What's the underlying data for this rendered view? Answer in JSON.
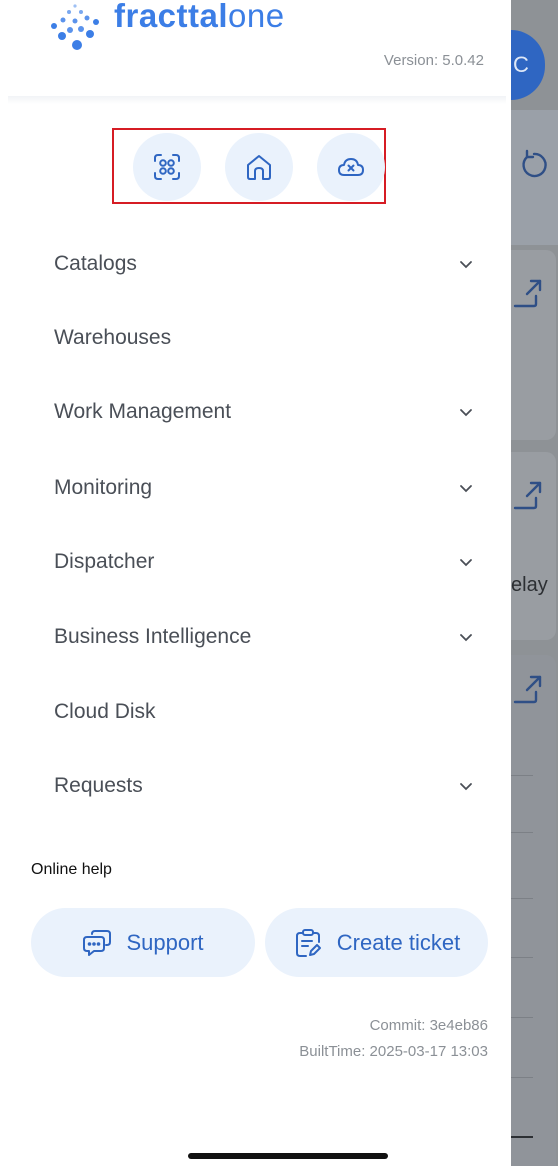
{
  "app": {
    "brand_name": "fracttal",
    "brand_suffix": "one",
    "version": "Version: 5.0.42"
  },
  "quick_actions": [
    {
      "name": "scan",
      "icon": "scan-icon"
    },
    {
      "name": "home",
      "icon": "home-icon"
    },
    {
      "name": "offline-cloud",
      "icon": "cloud-off-icon"
    }
  ],
  "menu": {
    "items": [
      {
        "label": "Catalogs",
        "expandable": true
      },
      {
        "label": "Warehouses",
        "expandable": false
      },
      {
        "label": "Work Management",
        "expandable": true
      },
      {
        "label": "Monitoring",
        "expandable": true
      },
      {
        "label": "Dispatcher",
        "expandable": true
      },
      {
        "label": "Business Intelligence",
        "expandable": true
      },
      {
        "label": "Cloud Disk",
        "expandable": false
      },
      {
        "label": "Requests",
        "expandable": true
      }
    ]
  },
  "help": {
    "title": "Online help",
    "support_label": "Support",
    "ticket_label": "Create ticket"
  },
  "build": {
    "commit": "Commit: 3e4eb86",
    "built_time": "BuiltTime: 2025-03-17 13:03"
  },
  "background": {
    "avatar_initial": "C",
    "partial_text": "elay"
  },
  "colors": {
    "brand": "#3c7ee6",
    "accent": "#2f66c2",
    "button_bg": "#eaf2fc",
    "highlight_border": "#d61c24",
    "overlay": "#8e9296"
  }
}
